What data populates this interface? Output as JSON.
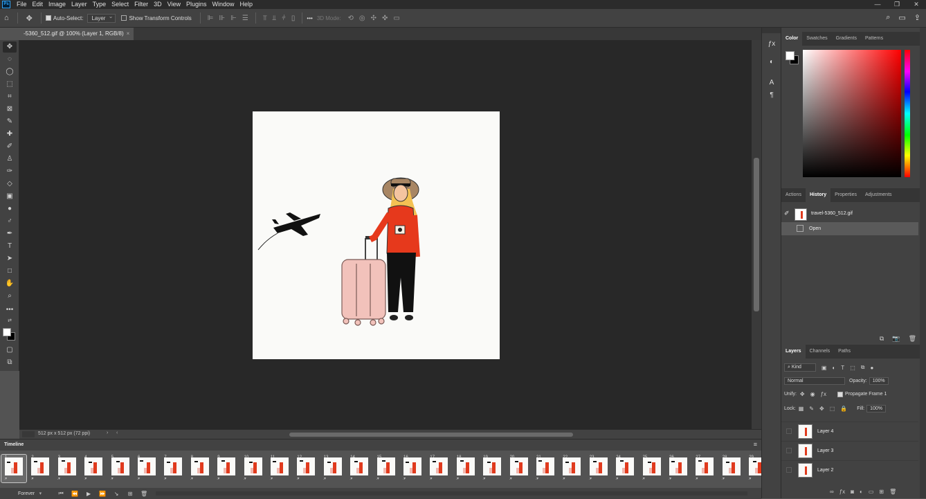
{
  "menubar": {
    "app_icon": "Ps",
    "items": [
      "File",
      "Edit",
      "Image",
      "Layer",
      "Type",
      "Select",
      "Filter",
      "3D",
      "View",
      "Plugins",
      "Window",
      "Help"
    ],
    "window_controls": [
      "—",
      "❐",
      "✕"
    ]
  },
  "options": {
    "auto_select_label": "Auto-Select:",
    "auto_select_value": "Layer",
    "transform_label": "Show Transform Controls",
    "mode_3d_label": "3D Mode:",
    "more": "•••"
  },
  "document": {
    "tab_title": "-5360_512.gif @ 100% (Layer 1, RGB/8)",
    "tab_close": "×",
    "status_dims": "512 px x 512 px (72 ppi)",
    "status_arrow": "›",
    "hscroll_left": "‹"
  },
  "timeline": {
    "title": "Timeline",
    "loop": "Forever",
    "frames": [
      "1",
      "2",
      "3",
      "4",
      "5",
      "6",
      "7",
      "8",
      "9",
      "10",
      "11",
      "12",
      "13",
      "14",
      "15",
      "16",
      "17",
      "18",
      "19",
      "20",
      "21",
      "22",
      "23",
      "24",
      "25",
      "26",
      "27",
      "28",
      "29"
    ],
    "delay": "0 sec.▾"
  },
  "color_panel": {
    "tabs": [
      "Color",
      "Swatches",
      "Gradients",
      "Patterns"
    ],
    "active_tab": "Color",
    "foreground": "#ffffff",
    "background": "#000000"
  },
  "history_panel": {
    "tabs": [
      "Actions",
      "History",
      "Properties",
      "Adjustments"
    ],
    "active_tab": "History",
    "entries": [
      "travel-5360_512.gif",
      "Open"
    ]
  },
  "layers_panel": {
    "tabs": [
      "Layers",
      "Channels",
      "Paths"
    ],
    "active_tab": "Layers",
    "kind_label": "Kind",
    "blend_mode": "Normal",
    "opacity_label": "Opacity:",
    "opacity_value": "100%",
    "unify_label": "Unify:",
    "propagate_label": "Propagate Frame 1",
    "lock_label": "Lock:",
    "fill_label": "Fill:",
    "fill_value": "100%",
    "layers": [
      "Layer 4",
      "Layer 3",
      "Layer 2"
    ]
  },
  "colors": {
    "shirt": "#e6391c",
    "suitcase": "#f2c2bb",
    "hat": "#a88664"
  }
}
